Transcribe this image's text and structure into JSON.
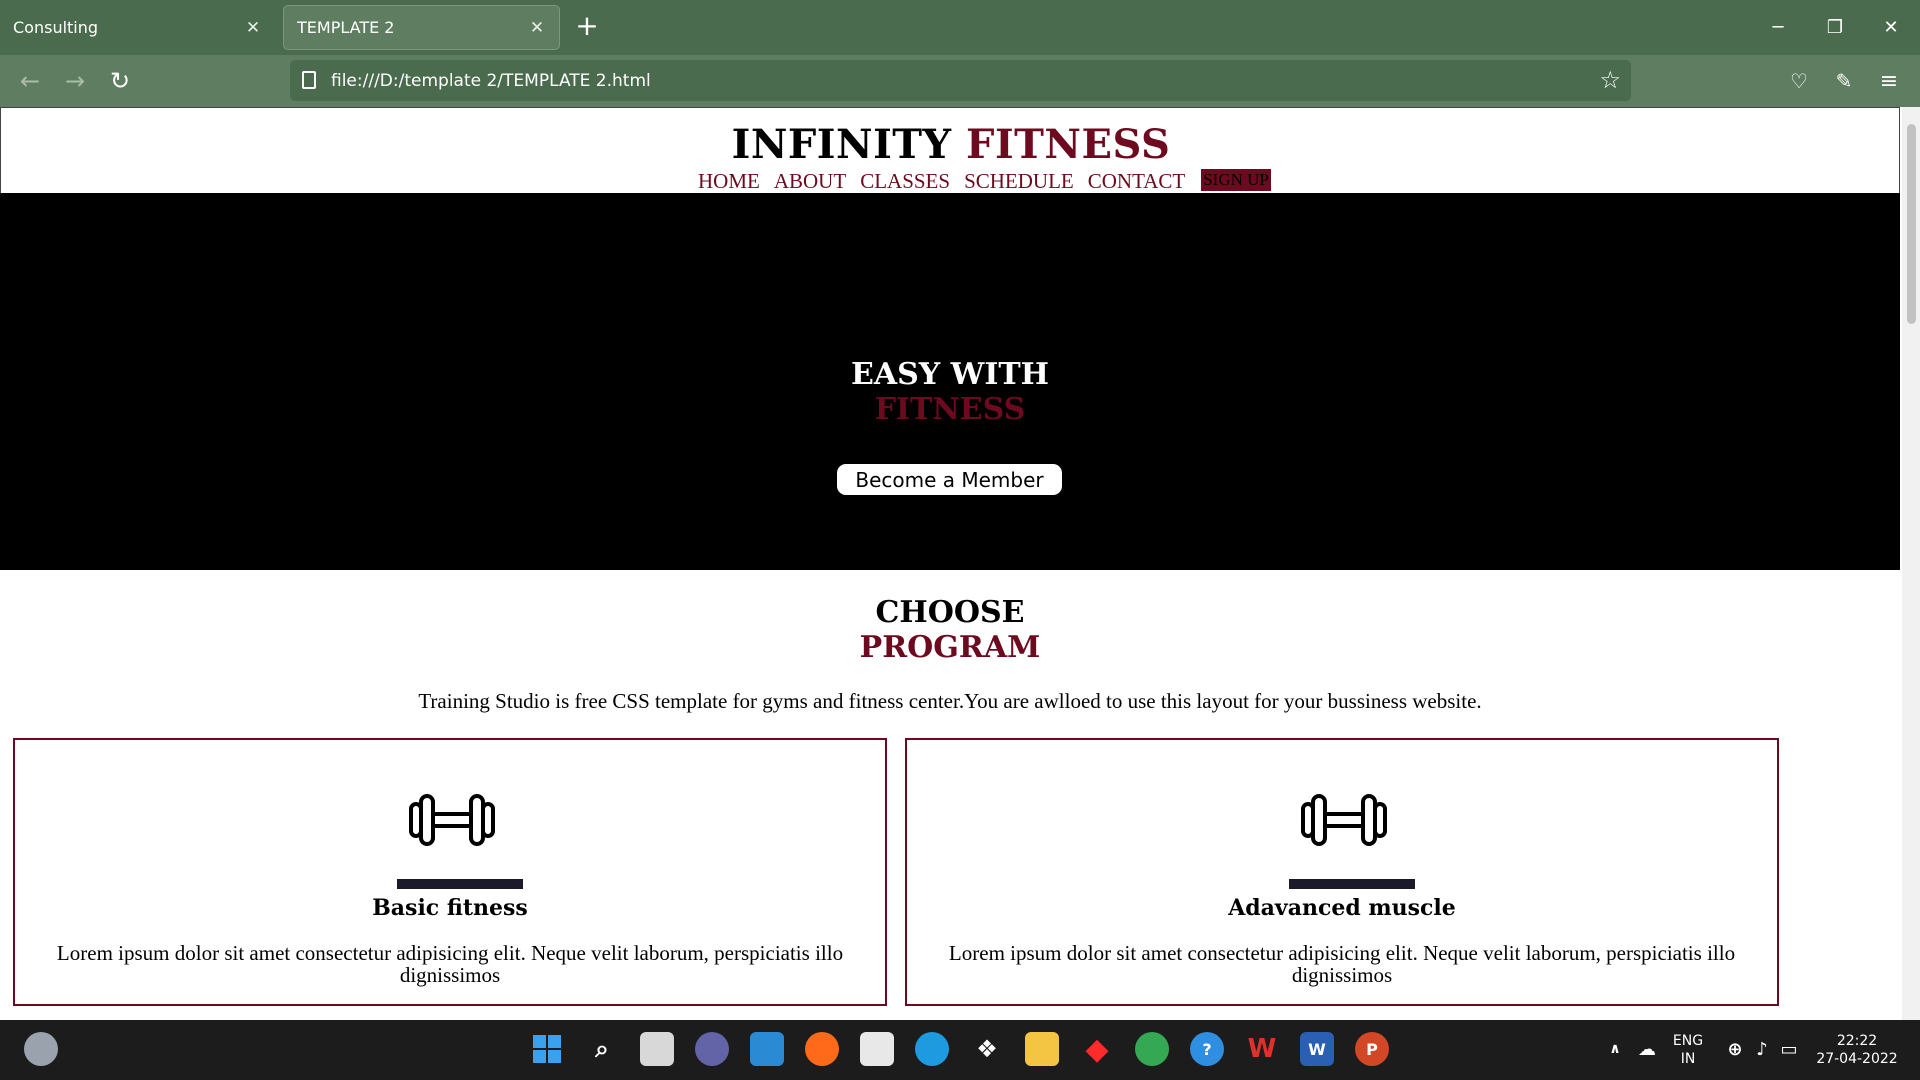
{
  "browser": {
    "tabs": [
      {
        "title": "Consulting"
      },
      {
        "title": "TEMPLATE 2"
      }
    ],
    "new_tab_symbol": "+",
    "url": "file:///D:/template 2/TEMPLATE 2.html"
  },
  "site": {
    "logo_main": "INFINITY",
    "logo_accent": "FITNESS",
    "menu": [
      "HOME",
      "ABOUT",
      "CLASSES",
      "SCHEDULE",
      "CONTACT"
    ],
    "signup": "SIGN UP",
    "hero": {
      "line1": "EASY WITH",
      "line2": "FITNESS",
      "button": "Become a Member"
    },
    "section": {
      "line1": "CHOOSE",
      "line2": "PROGRAM",
      "intro": "Training Studio is free CSS template for gyms and fitness center.You are awlloed to use this layout for your bussiness website."
    },
    "cards": [
      {
        "title": "Basic fitness",
        "text": "Lorem ipsum dolor sit amet consectetur adipisicing elit. Neque velit laborum, perspiciatis illo dignissimos"
      },
      {
        "title": "Adavanced muscle",
        "text": "Lorem ipsum dolor sit amet consectetur adipisicing elit. Neque velit laborum, perspiciatis illo dignissimos"
      }
    ],
    "colors": {
      "accent": "#6d0a1f",
      "hero_bg": "#000000"
    }
  },
  "taskbar": {
    "language": "ENG",
    "region": "IN",
    "time": "22:22",
    "date": "27-04-2022"
  }
}
